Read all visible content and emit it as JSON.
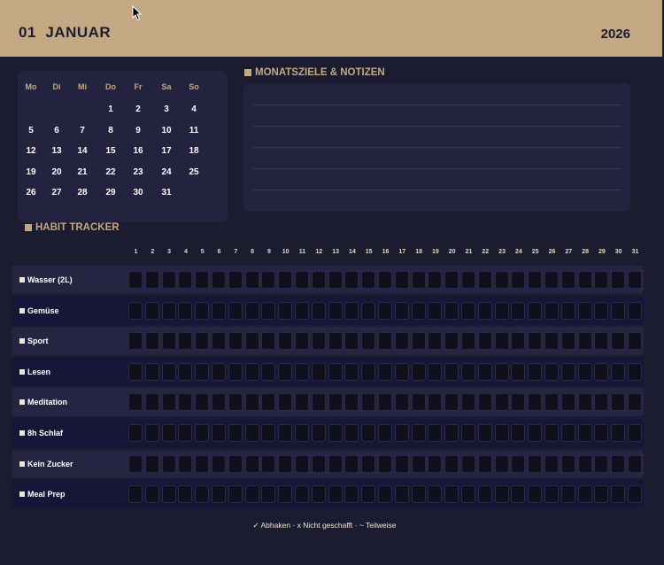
{
  "header": {
    "month_label": "01  JANUAR",
    "year_label": "2026"
  },
  "calendar": {
    "weekdays": [
      "Mo",
      "Di",
      "Mi",
      "Do",
      "Fr",
      "Sa",
      "So"
    ],
    "weeks": [
      [
        "",
        "",
        "",
        "1",
        "2",
        "3",
        "4"
      ],
      [
        "5",
        "6",
        "7",
        "8",
        "9",
        "10",
        "11"
      ],
      [
        "12",
        "13",
        "14",
        "15",
        "16",
        "17",
        "18"
      ],
      [
        "19",
        "20",
        "21",
        "22",
        "23",
        "24",
        "25"
      ],
      [
        "26",
        "27",
        "28",
        "29",
        "30",
        "31",
        ""
      ]
    ]
  },
  "notes": {
    "title": "MONATSZIELE & NOTIZEN"
  },
  "habits": {
    "title": "HABIT TRACKER",
    "days": [
      "1",
      "2",
      "3",
      "4",
      "5",
      "6",
      "7",
      "8",
      "9",
      "10",
      "11",
      "12",
      "13",
      "14",
      "15",
      "16",
      "17",
      "18",
      "19",
      "20",
      "21",
      "22",
      "23",
      "24",
      "25",
      "26",
      "27",
      "28",
      "29",
      "30",
      "31"
    ],
    "items": [
      {
        "label": "Wasser (2L)"
      },
      {
        "label": "Gemüse"
      },
      {
        "label": "Sport"
      },
      {
        "label": "Lesen"
      },
      {
        "label": "Meditation"
      },
      {
        "label": "8h Schlaf"
      },
      {
        "label": "Kein Zucker"
      },
      {
        "label": "Meal Prep"
      }
    ]
  },
  "legend": "✓ Abhaken · x Nicht geschafft · ~ Teilweise",
  "colors": {
    "accent": "#c4a883",
    "background": "#1c1c30",
    "panel": "#23233f",
    "cell": "#10101c"
  }
}
